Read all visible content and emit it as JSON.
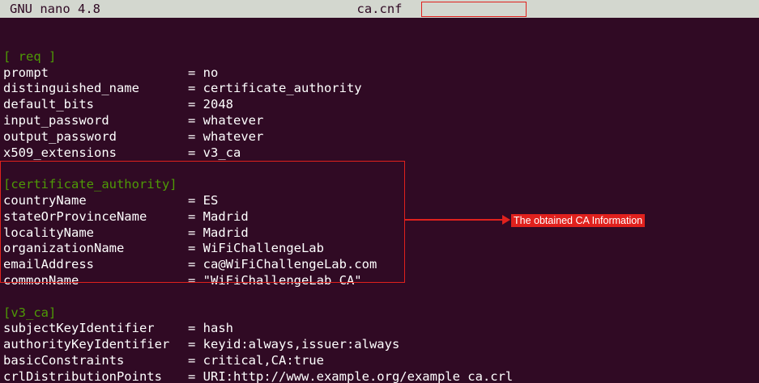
{
  "titlebar": {
    "app": "GNU nano 4.8",
    "filename": "ca.cnf"
  },
  "editor": {
    "lines": [
      {
        "type": "blank"
      },
      {
        "type": "section",
        "text": "[ req ]"
      },
      {
        "type": "kv",
        "key": "prompt",
        "value": "= no"
      },
      {
        "type": "kv",
        "key": "distinguished_name",
        "value": "= certificate_authority"
      },
      {
        "type": "kv",
        "key": "default_bits",
        "value": "= 2048"
      },
      {
        "type": "kv",
        "key": "input_password",
        "value": "= whatever"
      },
      {
        "type": "kv",
        "key": "output_password",
        "value": "= whatever"
      },
      {
        "type": "kv",
        "key": "x509_extensions",
        "value": "= v3_ca"
      },
      {
        "type": "blank"
      },
      {
        "type": "section",
        "text": "[certificate_authority]"
      },
      {
        "type": "kv",
        "key": "countryName",
        "value": "= ES"
      },
      {
        "type": "kv",
        "key": "stateOrProvinceName",
        "value": "= Madrid"
      },
      {
        "type": "kv",
        "key": "localityName",
        "value": "= Madrid"
      },
      {
        "type": "kv",
        "key": "organizationName",
        "value": "= WiFiChallengeLab"
      },
      {
        "type": "kv",
        "key": "emailAddress",
        "value": "= ca@WiFiChallengeLab.com"
      },
      {
        "type": "kv",
        "key": "commonName",
        "value": "= \"WiFiChallengeLab CA\""
      },
      {
        "type": "blank"
      },
      {
        "type": "section",
        "text": "[v3_ca]"
      },
      {
        "type": "kv",
        "key": "subjectKeyIdentifier",
        "value": "= hash"
      },
      {
        "type": "kv",
        "key": "authorityKeyIdentifier",
        "value": "= keyid:always,issuer:always"
      },
      {
        "type": "kv",
        "key": "basicConstraints",
        "value": "= critical,CA:true"
      },
      {
        "type": "kv",
        "key": "crlDistributionPoints",
        "value": "= URI:http://www.example.org/example_ca.crl"
      }
    ]
  },
  "annotation": {
    "callout_text": "The obtained CA Information",
    "color": "#e0211d"
  },
  "colors": {
    "terminal_background": "#300a24",
    "titlebar_background": "#d3d7cf",
    "section_header": "#4e9a06",
    "text": "#ffffff"
  }
}
